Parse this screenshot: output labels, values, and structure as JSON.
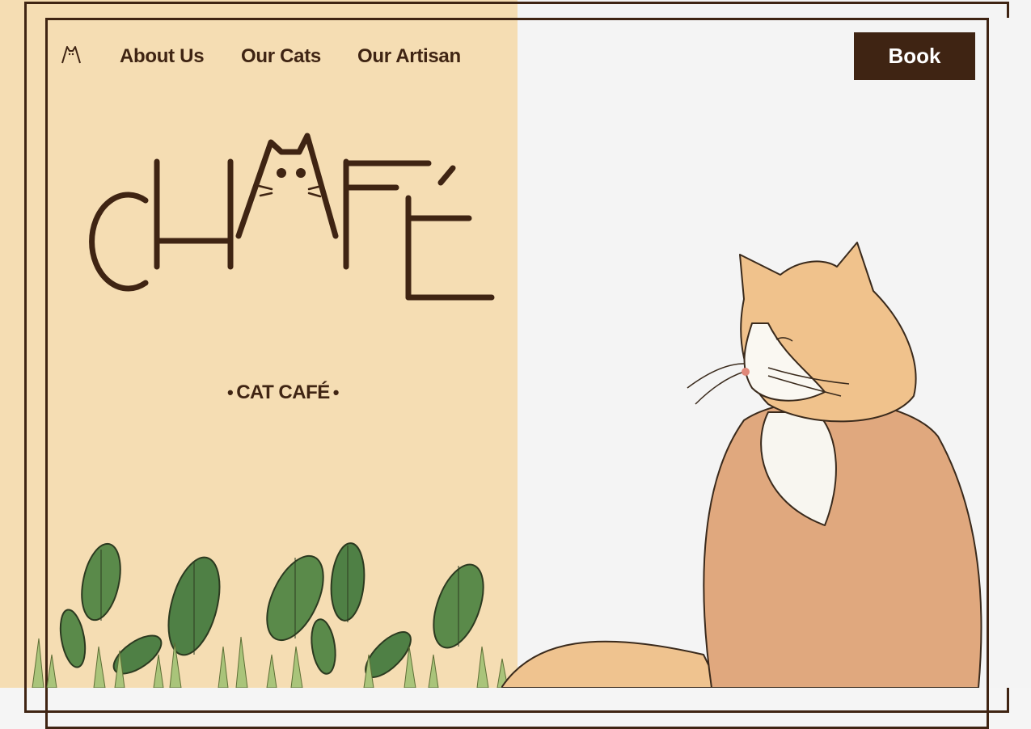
{
  "nav": {
    "links": [
      {
        "label": "About Us"
      },
      {
        "label": "Our Cats"
      },
      {
        "label": "Our Artisan"
      }
    ],
    "book_label": "Book"
  },
  "hero": {
    "logo_text": "CHAFÉ",
    "tagline": "CAT CAFÉ"
  },
  "colors": {
    "brand_brown": "#3f2413",
    "panel_cream": "#f5ddb3",
    "panel_light": "#f4f4f4",
    "leaf_green": "#5a8a4a",
    "cat_orange": "#e0a37c"
  },
  "icons": {
    "nav_logo": "cat-ears-icon"
  }
}
